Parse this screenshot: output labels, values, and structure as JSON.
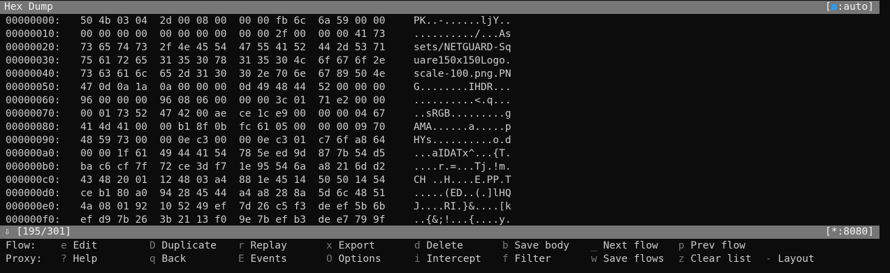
{
  "title_bar": {
    "title": "Hex Dump",
    "view_mode_open": "[",
    "view_mode_dot": "■",
    "view_mode_rest": ":auto]"
  },
  "dump_rows": [
    {
      "offset": "00000000:",
      "hex": "50 4b 03 04  2d 00 08 00  00 00 fb 6c  6a 59 00 00",
      "ascii": "PK..-......ljY.."
    },
    {
      "offset": "00000010:",
      "hex": "00 00 00 00  00 00 00 00  00 00 2f 00  00 00 41 73",
      "ascii": "........../...As"
    },
    {
      "offset": "00000020:",
      "hex": "73 65 74 73  2f 4e 45 54  47 55 41 52  44 2d 53 71",
      "ascii": "sets/NETGUARD-Sq"
    },
    {
      "offset": "00000030:",
      "hex": "75 61 72 65  31 35 30 78  31 35 30 4c  6f 67 6f 2e",
      "ascii": "uare150x150Logo."
    },
    {
      "offset": "00000040:",
      "hex": "73 63 61 6c  65 2d 31 30  30 2e 70 6e  67 89 50 4e",
      "ascii": "scale-100.png.PN"
    },
    {
      "offset": "00000050:",
      "hex": "47 0d 0a 1a  0a 00 00 00  0d 49 48 44  52 00 00 00",
      "ascii": "G........IHDR..."
    },
    {
      "offset": "00000060:",
      "hex": "96 00 00 00  96 08 06 00  00 00 3c 01  71 e2 00 00",
      "ascii": "..........<.q..."
    },
    {
      "offset": "00000070:",
      "hex": "00 01 73 52  47 42 00 ae  ce 1c e9 00  00 00 04 67",
      "ascii": "..sRGB.........g"
    },
    {
      "offset": "00000080:",
      "hex": "41 4d 41 00  00 b1 8f 0b  fc 61 05 00  00 00 09 70",
      "ascii": "AMA......a.....p"
    },
    {
      "offset": "00000090:",
      "hex": "48 59 73 00  00 0e c3 00  00 0e c3 01  c7 6f a8 64",
      "ascii": "HYs..........o.d"
    },
    {
      "offset": "000000a0:",
      "hex": "00 00 1f 61  49 44 41 54  78 5e ed 9d  87 7b 54 d5",
      "ascii": "...aIDATx^...{T."
    },
    {
      "offset": "000000b0:",
      "hex": "ba c6 cf 7f  72 ce 3d f7  1e 95 54 6a  a8 21 6d d2",
      "ascii": "....r.=...Tj.!m."
    },
    {
      "offset": "000000c0:",
      "hex": "43 48 20 01  12 48 03 a4  88 1e 45 14  50 50 14 54",
      "ascii": "CH ..H....E.PP.T"
    },
    {
      "offset": "000000d0:",
      "hex": "ce b1 80 a0  94 28 45 44  a4 a8 28 8a  5d 6c 48 51",
      "ascii": ".....(ED..(.]lHQ"
    },
    {
      "offset": "000000e0:",
      "hex": "4a 08 01 92  10 52 49 ef  7d 26 c5 f3  de ef 5b 6b",
      "ascii": "J....RI.}&....[k"
    },
    {
      "offset": "000000f0:",
      "hex": "ef d9 7b 26  3b 21 13 f0  9e 7b ef b3  de e7 79 9f",
      "ascii": "..{&;!...{....y."
    }
  ],
  "status_bar": {
    "arrow": "⇩",
    "position": "[195/301]",
    "listen": "[*:8080]"
  },
  "keybindings": {
    "flow_label": "Flow:",
    "proxy_label": "Proxy:",
    "flow": [
      {
        "key": "e",
        "label": "Edit"
      },
      {
        "key": "D",
        "label": "Duplicate"
      },
      {
        "key": "r",
        "label": "Replay"
      },
      {
        "key": "x",
        "label": "Export"
      },
      {
        "key": "d",
        "label": "Delete"
      },
      {
        "key": "b",
        "label": "Save body"
      },
      {
        "key": "_",
        "label": "Next flow"
      },
      {
        "key": "p",
        "label": "Prev flow"
      }
    ],
    "proxy": [
      {
        "key": "?",
        "label": "Help"
      },
      {
        "key": "q",
        "label": "Back"
      },
      {
        "key": "E",
        "label": "Events"
      },
      {
        "key": "O",
        "label": "Options"
      },
      {
        "key": "i",
        "label": "Intercept"
      },
      {
        "key": "f",
        "label": "Filter"
      },
      {
        "key": "w",
        "label": "Save flows"
      },
      {
        "key": "z",
        "label": "Clear list"
      },
      {
        "key": "-",
        "label": "Layout"
      }
    ]
  }
}
